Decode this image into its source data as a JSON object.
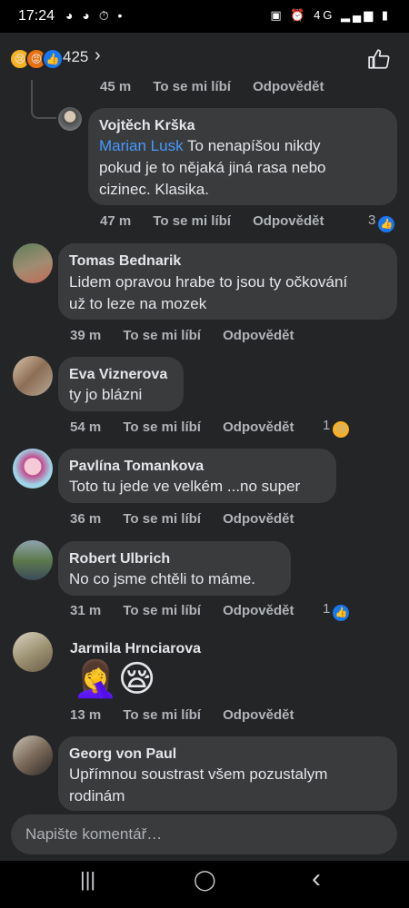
{
  "status_bar": {
    "time": "17:24",
    "left_icons": "◕ ◕ ⏱ •",
    "right_icons": "▣ ⏰ 4G ▂▄▆ ▮"
  },
  "reactions_bar": {
    "count": "425",
    "types": [
      "sad",
      "angry",
      "like"
    ]
  },
  "composer": {
    "placeholder": "Napište komentář…"
  },
  "comments": [
    {
      "time": "45 m",
      "like": "To se mi líbí",
      "reply": "Odpovědět"
    },
    {
      "name": "Vojtěch Krška",
      "mention": "Marian Lusk",
      "lines": [
        "To nenapíšou nikdy",
        "pokud je to nějaká jiná rasa nebo",
        "cizinec. Klasika."
      ],
      "time": "47 m",
      "like": "To se mi líbí",
      "reply": "Odpovědět",
      "reactions": "3"
    },
    {
      "name": "Tomas Bednarik",
      "lines": [
        "Lidem opravou hrabe to jsou ty očkování",
        "už to leze na mozek"
      ],
      "time": "39 m",
      "like": "To se mi líbí",
      "reply": "Odpovědět"
    },
    {
      "name": "Eva Viznerova",
      "lines": [
        "ty jo blázni"
      ],
      "time": "54 m",
      "like": "To se mi líbí",
      "reply": "Odpovědět",
      "reactions": "1"
    },
    {
      "name": "Pavlína Tomankova",
      "lines": [
        "Toto tu jede ve velkém ...no super"
      ],
      "time": "36 m",
      "like": "To se mi líbí",
      "reply": "Odpovědět"
    },
    {
      "name": "Robert Ulbrich",
      "lines": [
        "No co jsme chtěli to máme."
      ],
      "time": "31 m",
      "like": "To se mi líbí",
      "reply": "Odpovědět",
      "reactions": "1"
    },
    {
      "name": "Jarmila Hrnciarova",
      "emojis": "🤦‍♀️😪",
      "time": "13 m",
      "like": "To se mi líbí",
      "reply": "Odpovědět"
    },
    {
      "name": "Georg von Paul",
      "lines": [
        "Upřímnou soustrast všem pozustalym",
        "rodinám"
      ]
    }
  ],
  "nav": {
    "recents": "|||",
    "home": "◯",
    "back": "‹"
  }
}
